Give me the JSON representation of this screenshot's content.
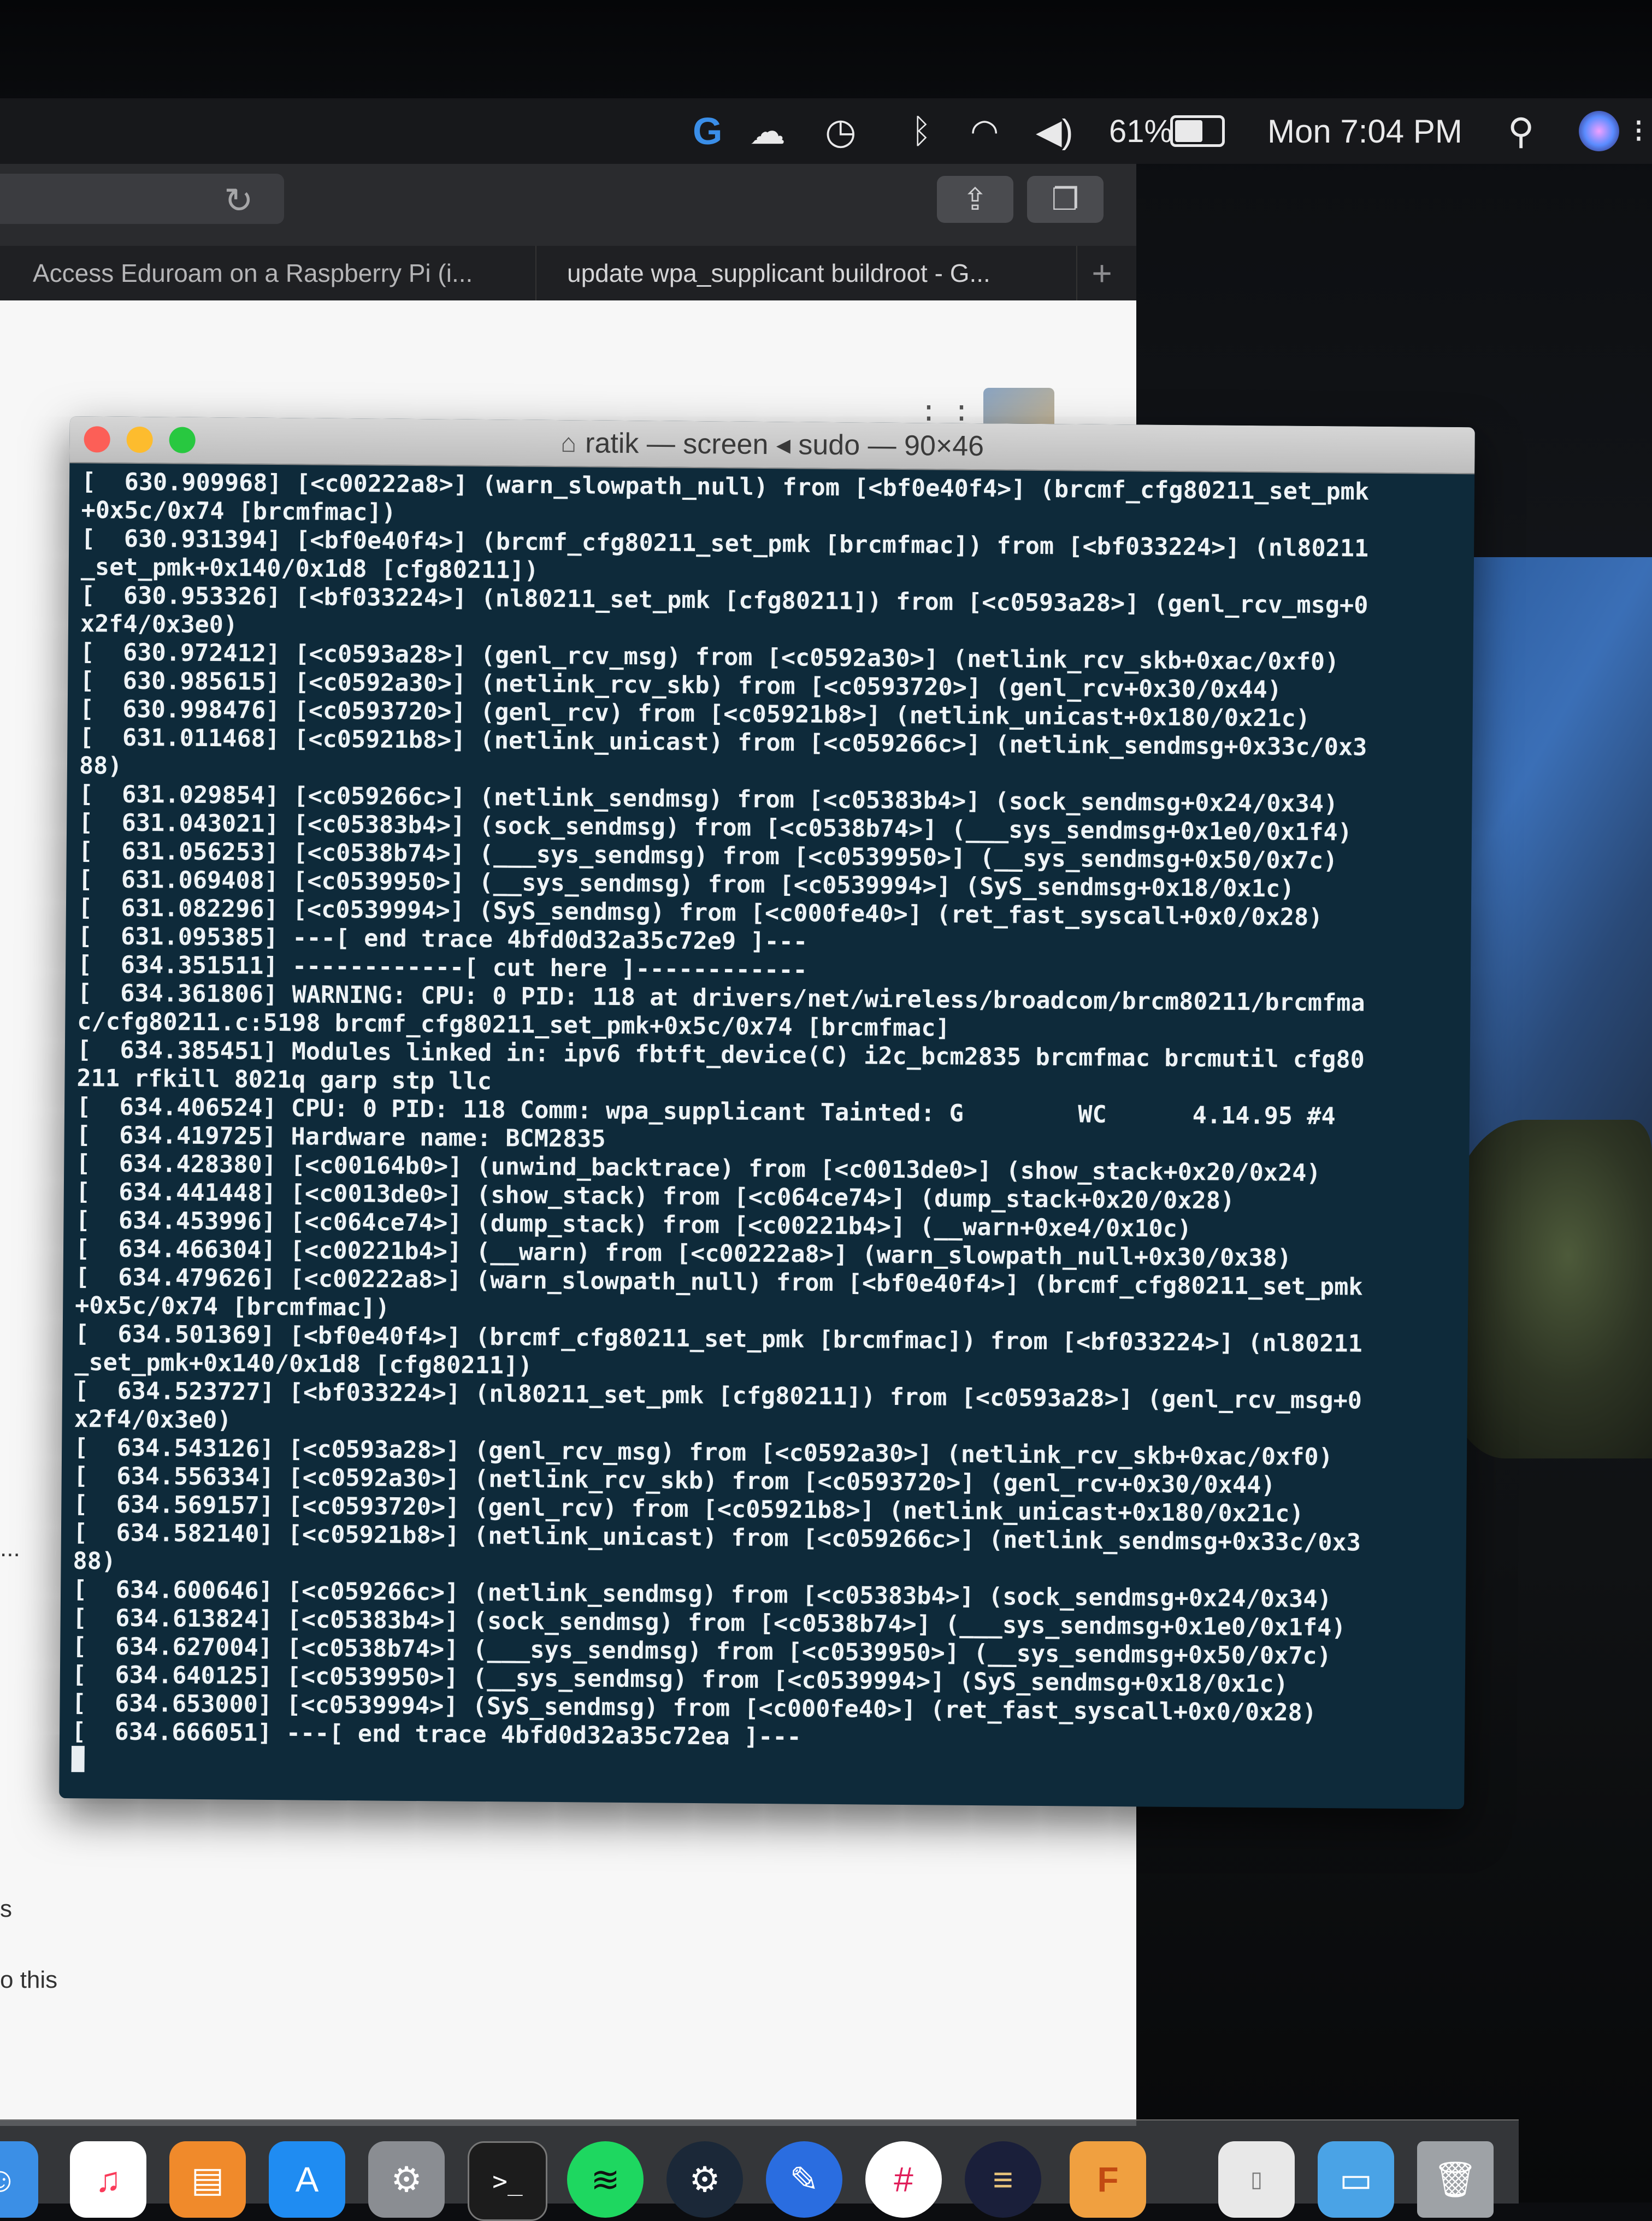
{
  "menubar": {
    "battery_percent": "61%",
    "clock": "Mon 7:04 PM",
    "icons": [
      "g-app-icon",
      "cloud-upload-icon",
      "time-machine-icon",
      "bluetooth-icon",
      "wifi-icon",
      "volume-icon",
      "battery-icon",
      "spotlight-icon",
      "siri-icon",
      "menu-extras-icon"
    ]
  },
  "browser": {
    "tabs": [
      {
        "label": "Access Eduroam on a Raspberry Pi (i..."
      },
      {
        "label": "update wpa_supplicant buildroot - G..."
      }
    ],
    "page_snippets": [
      "...",
      "s",
      "o this"
    ]
  },
  "terminal": {
    "title": "ratik — screen ◂ sudo — 90×46",
    "lines": [
      "[  630.909968] [<c00222a8>] (warn_slowpath_null) from [<bf0e40f4>] (brcmf_cfg80211_set_pmk",
      "+0x5c/0x74 [brcmfmac])",
      "[  630.931394] [<bf0e40f4>] (brcmf_cfg80211_set_pmk [brcmfmac]) from [<bf033224>] (nl80211",
      "_set_pmk+0x140/0x1d8 [cfg80211])",
      "[  630.953326] [<bf033224>] (nl80211_set_pmk [cfg80211]) from [<c0593a28>] (genl_rcv_msg+0",
      "x2f4/0x3e0)",
      "[  630.972412] [<c0593a28>] (genl_rcv_msg) from [<c0592a30>] (netlink_rcv_skb+0xac/0xf0)",
      "[  630.985615] [<c0592a30>] (netlink_rcv_skb) from [<c0593720>] (genl_rcv+0x30/0x44)",
      "[  630.998476] [<c0593720>] (genl_rcv) from [<c05921b8>] (netlink_unicast+0x180/0x21c)",
      "[  631.011468] [<c05921b8>] (netlink_unicast) from [<c059266c>] (netlink_sendmsg+0x33c/0x3",
      "88)",
      "[  631.029854] [<c059266c>] (netlink_sendmsg) from [<c05383b4>] (sock_sendmsg+0x24/0x34)",
      "[  631.043021] [<c05383b4>] (sock_sendmsg) from [<c0538b74>] (___sys_sendmsg+0x1e0/0x1f4)",
      "[  631.056253] [<c0538b74>] (___sys_sendmsg) from [<c0539950>] (__sys_sendmsg+0x50/0x7c)",
      "[  631.069408] [<c0539950>] (__sys_sendmsg) from [<c0539994>] (SyS_sendmsg+0x18/0x1c)",
      "[  631.082296] [<c0539994>] (SyS_sendmsg) from [<c000fe40>] (ret_fast_syscall+0x0/0x28)",
      "[  631.095385] ---[ end trace 4bfd0d32a35c72e9 ]---",
      "[  634.351511] ------------[ cut here ]------------",
      "[  634.361806] WARNING: CPU: 0 PID: 118 at drivers/net/wireless/broadcom/brcm80211/brcmfma",
      "c/cfg80211.c:5198 brcmf_cfg80211_set_pmk+0x5c/0x74 [brcmfmac]",
      "[  634.385451] Modules linked in: ipv6 fbtft_device(C) i2c_bcm2835 brcmfmac brcmutil cfg80",
      "211 rfkill 8021q garp stp llc",
      "[  634.406524] CPU: 0 PID: 118 Comm: wpa_supplicant Tainted: G        WC      4.14.95 #4",
      "[  634.419725] Hardware name: BCM2835",
      "[  634.428380] [<c00164b0>] (unwind_backtrace) from [<c0013de0>] (show_stack+0x20/0x24)",
      "[  634.441448] [<c0013de0>] (show_stack) from [<c064ce74>] (dump_stack+0x20/0x28)",
      "[  634.453996] [<c064ce74>] (dump_stack) from [<c00221b4>] (__warn+0xe4/0x10c)",
      "[  634.466304] [<c00221b4>] (__warn) from [<c00222a8>] (warn_slowpath_null+0x30/0x38)",
      "[  634.479626] [<c00222a8>] (warn_slowpath_null) from [<bf0e40f4>] (brcmf_cfg80211_set_pmk",
      "+0x5c/0x74 [brcmfmac])",
      "[  634.501369] [<bf0e40f4>] (brcmf_cfg80211_set_pmk [brcmfmac]) from [<bf033224>] (nl80211",
      "_set_pmk+0x140/0x1d8 [cfg80211])",
      "[  634.523727] [<bf033224>] (nl80211_set_pmk [cfg80211]) from [<c0593a28>] (genl_rcv_msg+0",
      "x2f4/0x3e0)",
      "[  634.543126] [<c0593a28>] (genl_rcv_msg) from [<c0592a30>] (netlink_rcv_skb+0xac/0xf0)",
      "[  634.556334] [<c0592a30>] (netlink_rcv_skb) from [<c0593720>] (genl_rcv+0x30/0x44)",
      "[  634.569157] [<c0593720>] (genl_rcv) from [<c05921b8>] (netlink_unicast+0x180/0x21c)",
      "[  634.582140] [<c05921b8>] (netlink_unicast) from [<c059266c>] (netlink_sendmsg+0x33c/0x3",
      "88)",
      "[  634.600646] [<c059266c>] (netlink_sendmsg) from [<c05383b4>] (sock_sendmsg+0x24/0x34)",
      "[  634.613824] [<c05383b4>] (sock_sendmsg) from [<c0538b74>] (___sys_sendmsg+0x1e0/0x1f4)",
      "[  634.627004] [<c0538b74>] (___sys_sendmsg) from [<c0539950>] (__sys_sendmsg+0x50/0x7c)",
      "[  634.640125] [<c0539950>] (__sys_sendmsg) from [<c0539994>] (SyS_sendmsg+0x18/0x1c)",
      "[  634.653000] [<c0539994>] (SyS_sendmsg) from [<c000fe40>] (ret_fast_syscall+0x0/0x28)",
      "[  634.666051] ---[ end trace 4bfd0d32a35c72ea ]---"
    ]
  },
  "dock": {
    "apps": [
      "finder-icon",
      "music-icon",
      "books-icon",
      "app-store-icon",
      "system-preferences-icon",
      "terminal-icon",
      "spotify-icon",
      "steam-icon",
      "pencil-app-icon",
      "slack-icon",
      "launchpad-icon",
      "f-app-icon",
      "document-icon",
      "folder-icon",
      "trash-icon"
    ]
  },
  "colors": {
    "terminal_bg": "#0e2a3a",
    "terminal_text": "#eef3f6",
    "close": "#fc5f57",
    "minimize": "#fdbc2e",
    "zoom": "#28c840"
  }
}
